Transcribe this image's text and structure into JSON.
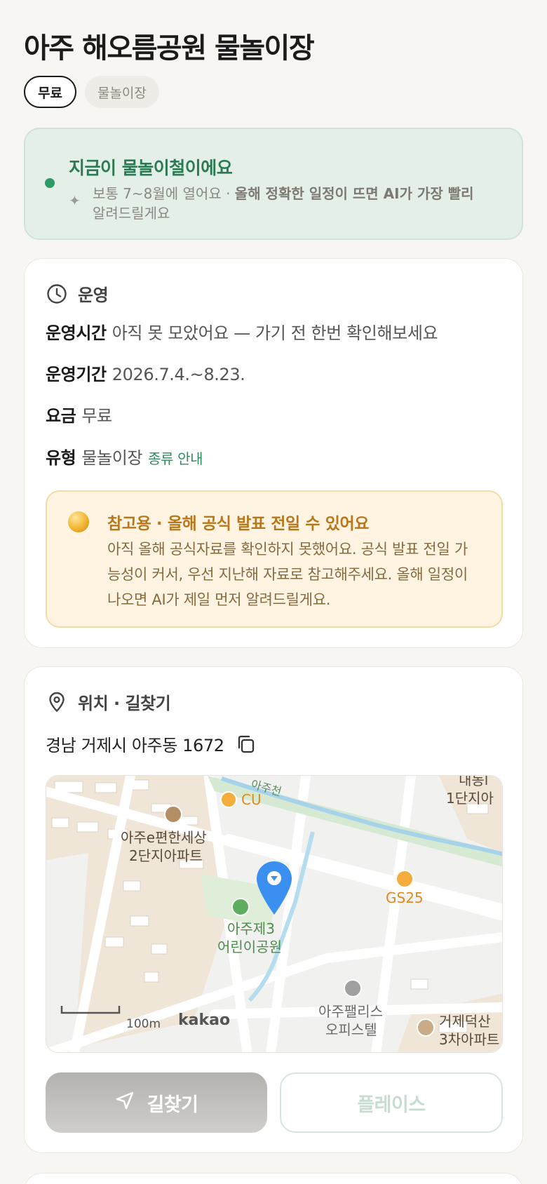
{
  "header": {
    "title": "아주 해오름공원 물놀이장",
    "chips": [
      "무료",
      "물놀이장"
    ]
  },
  "season": {
    "headline": "지금이 물놀이철이에요",
    "desc_prefix": "보통 7~8월에 열어요 · ",
    "desc_bold": "올해 정확한 일정이 뜨면 AI가 가장 빨리",
    "desc_line2": "알려드릴게요",
    "colors": {
      "bg": "#e3efe7",
      "accent": "#2c7a53"
    }
  },
  "operation": {
    "section_label": "운영",
    "hours_label": "운영시간",
    "hours_value": "아직 못 모았어요 — 가기 전 한번 확인해보세요",
    "period_label": "운영기간",
    "period_value": "2026.7.4.~8.23.",
    "fee_label": "요금",
    "fee_value": "무료",
    "type_label": "유형",
    "type_value": "물놀이장",
    "type_link": "종류 안내",
    "notice": {
      "title": "참고용 · 올해 공식 발표 전일 수 있어요",
      "body": "아직 올해 공식자료를 확인하지 못했어요. 공식 발표 전일 가능성이 커서, 우선 지난해 자료로 참고해주세요. 올해 일정이 나오면 AI가 제일 먼저 알려드릴게요."
    }
  },
  "location": {
    "section_label": "위치 · 길찾기",
    "address": "경남 거제시 아주동 1672",
    "map": {
      "labels": {
        "stream": "아주천",
        "store_cu": "CU",
        "store_gs": "GS25",
        "apt1_line1": "아주e편한세상",
        "apt1_line2": "2단지아파트",
        "apt_top_line1": "내동l",
        "apt_top_line2": "1단지아",
        "park_line1": "아주제3",
        "park_line2": "어린이공원",
        "office_line1": "아주팰리스",
        "office_line2": "오피스텔",
        "apt2_line1": "거제덕산",
        "apt2_line2": "3차아파트",
        "scale": "100m",
        "logo": "kakao"
      }
    },
    "nav_button": "길찾기",
    "place_button": "플레이스"
  }
}
